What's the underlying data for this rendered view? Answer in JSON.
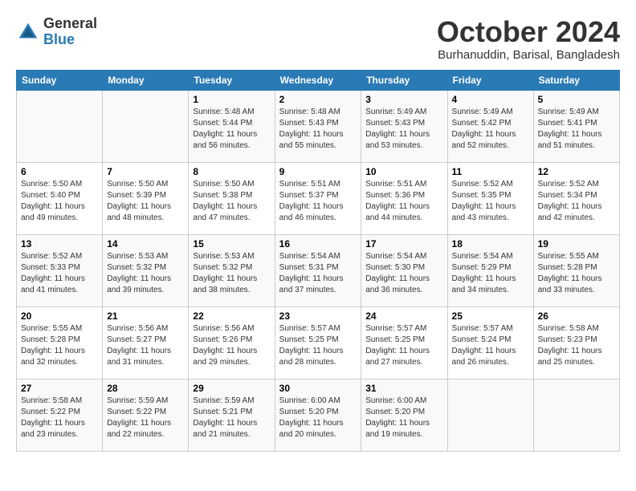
{
  "logo": {
    "general": "General",
    "blue": "Blue"
  },
  "title": "October 2024",
  "location": "Burhanuddin, Barisal, Bangladesh",
  "days_header": [
    "Sunday",
    "Monday",
    "Tuesday",
    "Wednesday",
    "Thursday",
    "Friday",
    "Saturday"
  ],
  "weeks": [
    [
      {
        "day": "",
        "info": ""
      },
      {
        "day": "",
        "info": ""
      },
      {
        "day": "1",
        "info": "Sunrise: 5:48 AM\nSunset: 5:44 PM\nDaylight: 11 hours and 56 minutes."
      },
      {
        "day": "2",
        "info": "Sunrise: 5:48 AM\nSunset: 5:43 PM\nDaylight: 11 hours and 55 minutes."
      },
      {
        "day": "3",
        "info": "Sunrise: 5:49 AM\nSunset: 5:43 PM\nDaylight: 11 hours and 53 minutes."
      },
      {
        "day": "4",
        "info": "Sunrise: 5:49 AM\nSunset: 5:42 PM\nDaylight: 11 hours and 52 minutes."
      },
      {
        "day": "5",
        "info": "Sunrise: 5:49 AM\nSunset: 5:41 PM\nDaylight: 11 hours and 51 minutes."
      }
    ],
    [
      {
        "day": "6",
        "info": "Sunrise: 5:50 AM\nSunset: 5:40 PM\nDaylight: 11 hours and 49 minutes."
      },
      {
        "day": "7",
        "info": "Sunrise: 5:50 AM\nSunset: 5:39 PM\nDaylight: 11 hours and 48 minutes."
      },
      {
        "day": "8",
        "info": "Sunrise: 5:50 AM\nSunset: 5:38 PM\nDaylight: 11 hours and 47 minutes."
      },
      {
        "day": "9",
        "info": "Sunrise: 5:51 AM\nSunset: 5:37 PM\nDaylight: 11 hours and 46 minutes."
      },
      {
        "day": "10",
        "info": "Sunrise: 5:51 AM\nSunset: 5:36 PM\nDaylight: 11 hours and 44 minutes."
      },
      {
        "day": "11",
        "info": "Sunrise: 5:52 AM\nSunset: 5:35 PM\nDaylight: 11 hours and 43 minutes."
      },
      {
        "day": "12",
        "info": "Sunrise: 5:52 AM\nSunset: 5:34 PM\nDaylight: 11 hours and 42 minutes."
      }
    ],
    [
      {
        "day": "13",
        "info": "Sunrise: 5:52 AM\nSunset: 5:33 PM\nDaylight: 11 hours and 41 minutes."
      },
      {
        "day": "14",
        "info": "Sunrise: 5:53 AM\nSunset: 5:32 PM\nDaylight: 11 hours and 39 minutes."
      },
      {
        "day": "15",
        "info": "Sunrise: 5:53 AM\nSunset: 5:32 PM\nDaylight: 11 hours and 38 minutes."
      },
      {
        "day": "16",
        "info": "Sunrise: 5:54 AM\nSunset: 5:31 PM\nDaylight: 11 hours and 37 minutes."
      },
      {
        "day": "17",
        "info": "Sunrise: 5:54 AM\nSunset: 5:30 PM\nDaylight: 11 hours and 36 minutes."
      },
      {
        "day": "18",
        "info": "Sunrise: 5:54 AM\nSunset: 5:29 PM\nDaylight: 11 hours and 34 minutes."
      },
      {
        "day": "19",
        "info": "Sunrise: 5:55 AM\nSunset: 5:28 PM\nDaylight: 11 hours and 33 minutes."
      }
    ],
    [
      {
        "day": "20",
        "info": "Sunrise: 5:55 AM\nSunset: 5:28 PM\nDaylight: 11 hours and 32 minutes."
      },
      {
        "day": "21",
        "info": "Sunrise: 5:56 AM\nSunset: 5:27 PM\nDaylight: 11 hours and 31 minutes."
      },
      {
        "day": "22",
        "info": "Sunrise: 5:56 AM\nSunset: 5:26 PM\nDaylight: 11 hours and 29 minutes."
      },
      {
        "day": "23",
        "info": "Sunrise: 5:57 AM\nSunset: 5:25 PM\nDaylight: 11 hours and 28 minutes."
      },
      {
        "day": "24",
        "info": "Sunrise: 5:57 AM\nSunset: 5:25 PM\nDaylight: 11 hours and 27 minutes."
      },
      {
        "day": "25",
        "info": "Sunrise: 5:57 AM\nSunset: 5:24 PM\nDaylight: 11 hours and 26 minutes."
      },
      {
        "day": "26",
        "info": "Sunrise: 5:58 AM\nSunset: 5:23 PM\nDaylight: 11 hours and 25 minutes."
      }
    ],
    [
      {
        "day": "27",
        "info": "Sunrise: 5:58 AM\nSunset: 5:22 PM\nDaylight: 11 hours and 23 minutes."
      },
      {
        "day": "28",
        "info": "Sunrise: 5:59 AM\nSunset: 5:22 PM\nDaylight: 11 hours and 22 minutes."
      },
      {
        "day": "29",
        "info": "Sunrise: 5:59 AM\nSunset: 5:21 PM\nDaylight: 11 hours and 21 minutes."
      },
      {
        "day": "30",
        "info": "Sunrise: 6:00 AM\nSunset: 5:20 PM\nDaylight: 11 hours and 20 minutes."
      },
      {
        "day": "31",
        "info": "Sunrise: 6:00 AM\nSunset: 5:20 PM\nDaylight: 11 hours and 19 minutes."
      },
      {
        "day": "",
        "info": ""
      },
      {
        "day": "",
        "info": ""
      }
    ]
  ]
}
